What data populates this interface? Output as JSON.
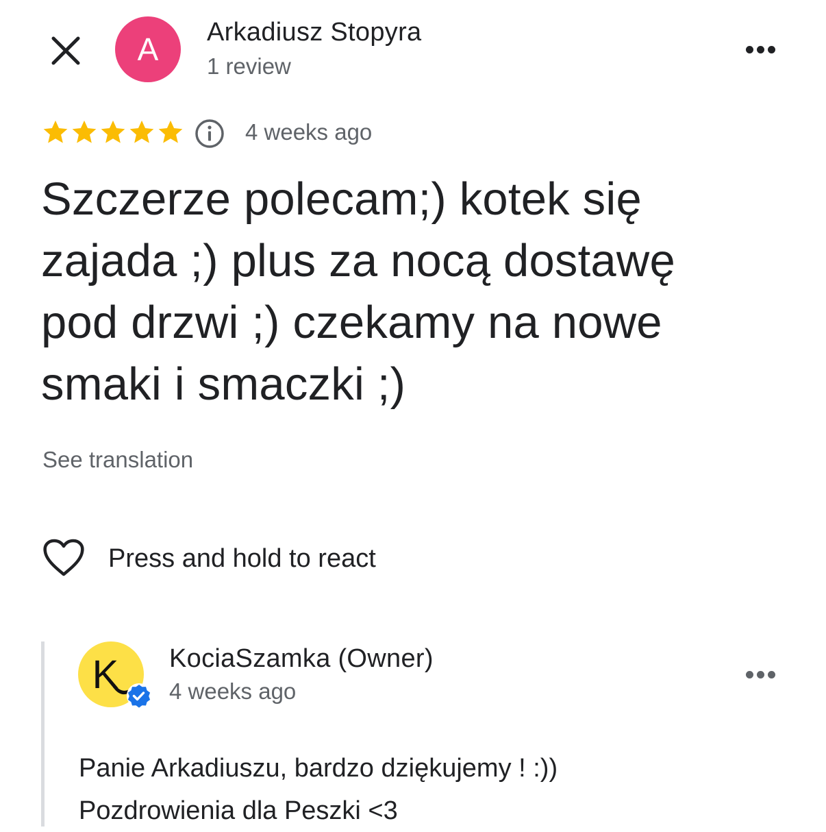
{
  "header": {
    "close_icon": "close-icon",
    "avatar_letter": "A",
    "avatar_color": "#ec407a",
    "reviewer_name": "Arkadiusz Stopyra",
    "review_count": "1 review",
    "more_icon": "more-horizontal-icon"
  },
  "review": {
    "rating": 5,
    "max_rating": 5,
    "star_color": "#fbbc04",
    "info_icon": "info-icon",
    "time": "4 weeks ago",
    "text_lines": [
      "Szczerze polecam;) kotek się",
      "zajada ;) plus za nocą dostawę",
      "pod drzwi ;) czekamy na nowe",
      "smaki i smaczki ;)"
    ],
    "see_translation": "See translation"
  },
  "reaction": {
    "heart_icon": "heart-outline-icon",
    "label": "Press and hold to react"
  },
  "owner_reply": {
    "avatar_letter": "K",
    "avatar_color": "#fde047",
    "verified_color": "#1a73e8",
    "name": "KociaSzamka (Owner)",
    "time": "4 weeks ago",
    "lines": [
      "Panie Arkadiuszu, bardzo dziękujemy ! :))",
      "Pozdrowienia dla Peszki <3"
    ],
    "more_icon": "more-horizontal-icon"
  }
}
